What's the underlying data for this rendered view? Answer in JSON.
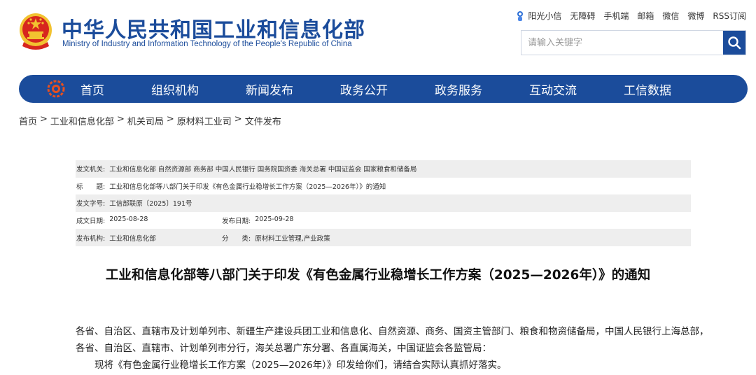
{
  "header": {
    "title_cn": "中华人民共和国工业和信息化部",
    "title_en": "Ministry of Industry and Information Technology of the People's Republic of China",
    "top_links": [
      "阳光小信",
      "无障碍",
      "手机端",
      "邮箱",
      "微信",
      "微博",
      "RSS订阅"
    ],
    "search_placeholder": "请输入关键字"
  },
  "nav": {
    "items": [
      "首页",
      "组织机构",
      "新闻发布",
      "政务公开",
      "政务服务",
      "互动交流",
      "工信数据"
    ]
  },
  "breadcrumb": [
    "首页",
    "工业和信息化部",
    "机关司局",
    "原材料工业司",
    "文件发布"
  ],
  "breadcrumb_sep": ">",
  "info": {
    "issuer_label": "发文机关:",
    "issuer_value": "工业和信息化部 自然资源部 商务部 中国人民银行 国务院国资委 海关总署 中国证监会 国家粮食和储备局",
    "title_label": "标　　题:",
    "title_value": "工业和信息化部等八部门关于印发《有色金属行业稳增长工作方案（2025—2026年）》的通知",
    "doc_no_label": "发文字号:",
    "doc_no_value": "工信部联原〔2025〕191号",
    "written_date_label": "成文日期:",
    "written_date_value": "2025-08-28",
    "publish_date_label": "发布日期:",
    "publish_date_value": "2025-09-28",
    "publisher_label": "发布机构:",
    "publisher_value": "工业和信息化部",
    "category_label": "分　　类:",
    "category_value": "原材料工业管理,产业政策"
  },
  "document": {
    "title": "工业和信息化部等八部门关于印发《有色金属行业稳增长工作方案（2025—2026年）》的通知",
    "paragraphs": [
      "各省、自治区、直辖市及计划单列市、新疆生产建设兵团工业和信息化、自然资源、商务、国资主管部门、粮食和物资储备局，中国人民银行上海总部，",
      "各省、自治区、直辖市、计划单列市分行，海关总署广东分署、各直属海关，中国证监会各监管局：",
      "现将《有色金属行业稳增长工作方案（2025—2026年）》印发给你们，请结合实际认真抓好落实。"
    ]
  },
  "colors": {
    "brand_blue": "#1b4c9b",
    "emblem_red": "#d7261e",
    "emblem_gold": "#f2c230"
  }
}
